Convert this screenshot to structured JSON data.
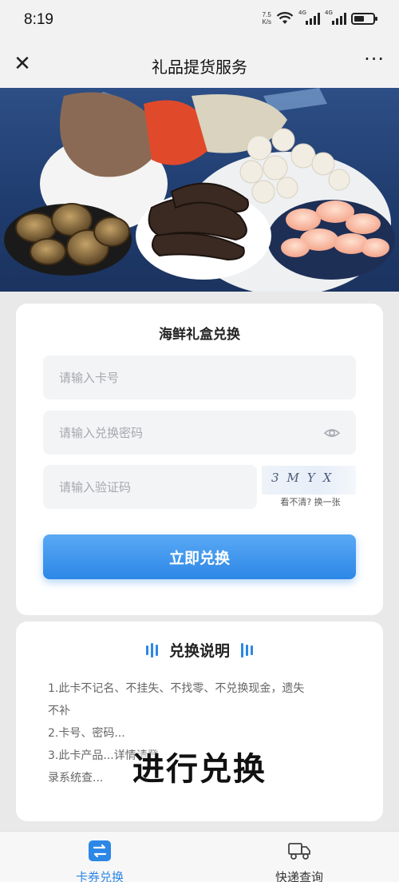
{
  "status_bar": {
    "time": "8:19",
    "net_speed_value": "7.5",
    "net_speed_unit": "K/s",
    "signal_labels": [
      "4G",
      "4G"
    ]
  },
  "nav": {
    "title": "礼品提货服务",
    "close_icon": "close-icon",
    "more_label": "···"
  },
  "form": {
    "title": "海鲜礼盒兑换",
    "card_number_placeholder": "请输入卡号",
    "password_placeholder": "请输入兑换密码",
    "captcha_placeholder": "请输入验证码",
    "captcha_code": "3MYX",
    "captcha_refresh": "看不清? 换一张",
    "submit_label": "立即兑换",
    "accent_color": "#2c87e6"
  },
  "instructions": {
    "title": "兑换说明",
    "lines": [
      "1.此卡不记名、不挂失、不找零、不兑换现金，遗失",
      "不补",
      "2.卡号、密码...",
      "3.此卡产品...详情请登",
      "录系统查..."
    ]
  },
  "overlay_caption": "进行兑换",
  "tabs": [
    {
      "label": "卡券兑换",
      "icon": "exchange-icon",
      "active": true
    },
    {
      "label": "快递查询",
      "icon": "delivery-truck-icon",
      "active": false
    }
  ]
}
